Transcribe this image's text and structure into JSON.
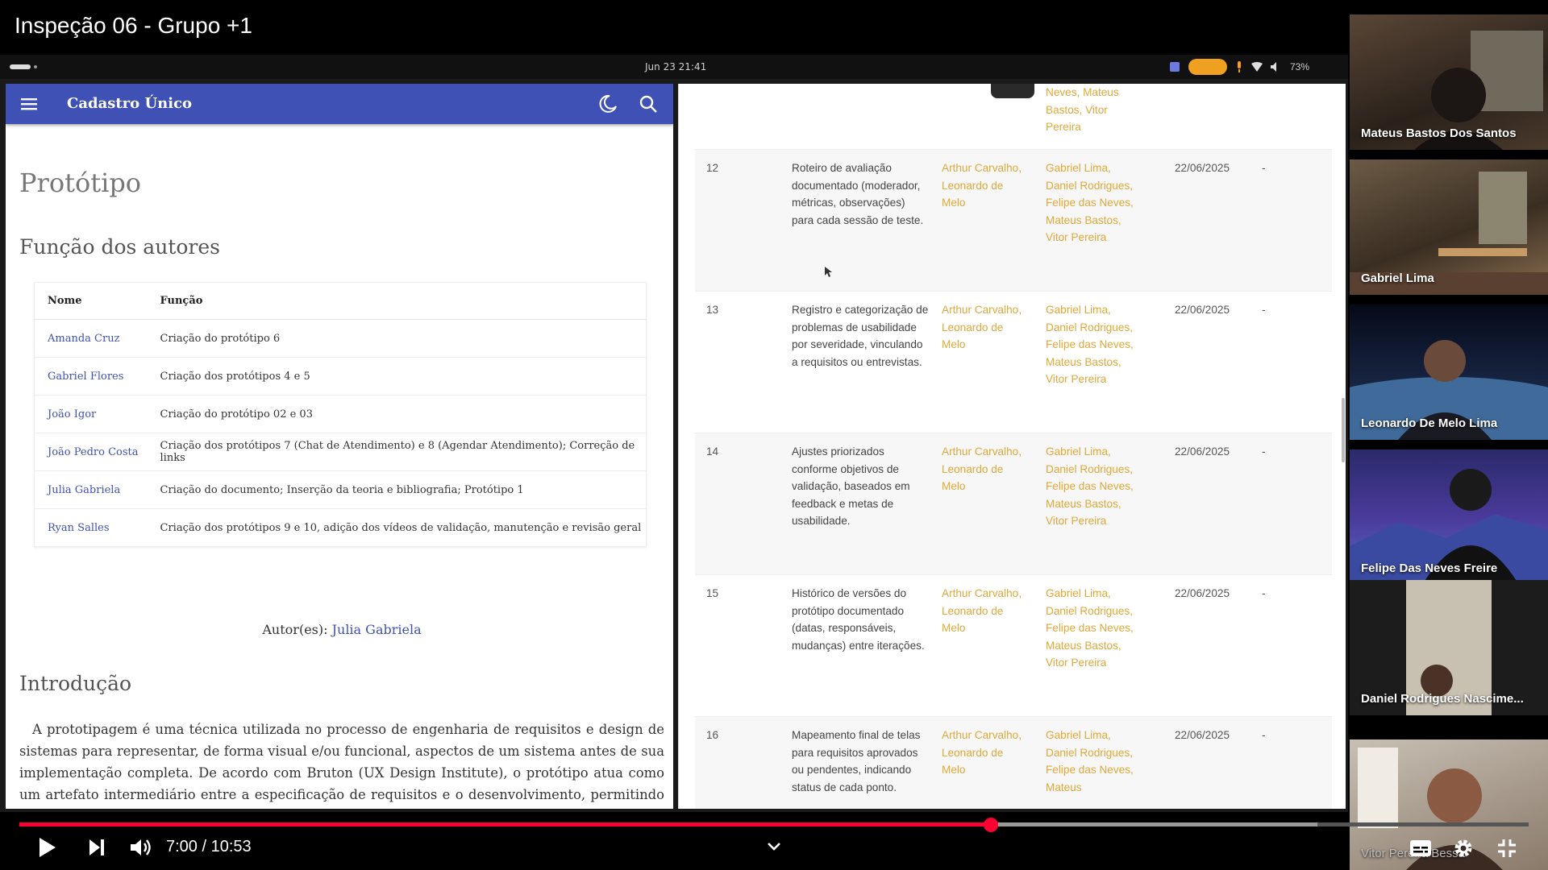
{
  "video": {
    "title": "Inspeção 06 - Grupo +1",
    "time_current": "7:00",
    "time_sep": " / ",
    "time_total": "10:53",
    "progress_fraction": 0.6437,
    "buffered_fraction": 0.86,
    "accent_color": "#ff0033"
  },
  "statusbar": {
    "datetime": "Jun 23  21:41",
    "battery": "73%"
  },
  "left_app": {
    "appbar_title": "Cadastro Único",
    "appbar_color": "#3f51b5",
    "page_title": "Protótipo",
    "section_authors": "Função dos autores",
    "table_headers": {
      "name": "Nome",
      "role": "Função"
    },
    "authors": [
      {
        "name": "Amanda Cruz",
        "role": "Criação do protótipo 6"
      },
      {
        "name": "Gabriel Flores",
        "role": "Criação dos protótipos 4 e 5"
      },
      {
        "name": "João Igor",
        "role": "Criação do protótipo 02 e 03"
      },
      {
        "name": "João Pedro Costa",
        "role": "Criação dos protótipos 7 (Chat de Atendimento) e 8 (Agendar Atendimento); Correção de links"
      },
      {
        "name": "Julia Gabriela",
        "role": "Criação do documento; Inserção da teoria e bibliografia; Protótipo 1"
      },
      {
        "name": "Ryan Salles",
        "role": "Criação dos protótipos 9 e 10, adição dos vídeos de validação, manutenção e revisão geral"
      }
    ],
    "author_label": "Autor(es): ",
    "author_link": "Julia Gabriela",
    "section_intro": "Introdução",
    "intro_text": "A prototipagem é uma técnica utilizada no processo de engenharia de requisitos e design de sistemas para representar, de forma visual e/ou funcional, aspectos de um sistema antes de sua implementação completa. De acordo com Bruton (UX Design Institute), o protótipo atua como um artefato intermediário entre a especificação de requisitos e o desenvolvimento, permitindo validar funcionalidades, fluxos de interação e regras de negócio com os stakeholders. Já Boicheva (2024) reforça que a prototipagem é essencial para detectar inconsistências, ambiguidade e requisitos incompletos, antecipando problemas que poderiam surgir nas fases posteriores do ciclo de vida do"
  },
  "right_app": {
    "top_partial": "Neves, Mateus Bastos, Vitor Pereira",
    "rows": [
      {
        "num": "12",
        "desc": "Roteiro de avaliação documentado (moderador, métricas, observações) para cada sessão de teste.",
        "resp": "Arthur Carvalho, Leonardo de Melo",
        "part": "Gabriel Lima, Daniel Rodrigues, Felipe das Neves, Mateus Bastos, Vitor Pereira",
        "date": "22/06/2025",
        "dash": "-"
      },
      {
        "num": "13",
        "desc": "Registro e categorização de problemas de usabilidade por severidade, vinculando a requisitos ou entrevistas.",
        "resp": "Arthur Carvalho, Leonardo de Melo",
        "part": "Gabriel Lima, Daniel Rodrigues, Felipe das Neves, Mateus Bastos, Vitor Pereira",
        "date": "22/06/2025",
        "dash": "-"
      },
      {
        "num": "14",
        "desc": "Ajustes priorizados conforme objetivos de validação, baseados em feedback e metas de usabilidade.",
        "resp": "Arthur Carvalho, Leonardo de Melo",
        "part": "Gabriel Lima, Daniel Rodrigues, Felipe das Neves, Mateus Bastos, Vitor Pereira",
        "date": "22/06/2025",
        "dash": "-"
      },
      {
        "num": "15",
        "desc": "Histórico de versões do protótipo documentado (datas, responsáveis, mudanças) entre iterações.",
        "resp": "Arthur Carvalho, Leonardo de Melo",
        "part": "Gabriel Lima, Daniel Rodrigues, Felipe das Neves, Mateus Bastos, Vitor Pereira",
        "date": "22/06/2025",
        "dash": "-"
      },
      {
        "num": "16",
        "desc": "Mapeamento final de telas para requisitos aprovados ou pendentes, indicando status de cada ponto.",
        "resp": "Arthur Carvalho, Leonardo de Melo",
        "part": "Gabriel Lima, Daniel Rodrigues, Felipe das Neves, Mateus",
        "date": "22/06/2025",
        "dash": "-"
      }
    ],
    "link_color": "#e0a838"
  },
  "participants": [
    {
      "name": "Mateus Bastos Dos Santos"
    },
    {
      "name": "Gabriel Lima"
    },
    {
      "name": "Leonardo De Melo Lima"
    },
    {
      "name": "Felipe Das Neves Freire"
    },
    {
      "name": "Daniel Rodrigues Nascime..."
    },
    {
      "name": "Vitor Pereira Bessa"
    }
  ],
  "icons": {
    "menu": "hamburger-icon",
    "dark_mode": "moon-icon",
    "search": "search-icon",
    "share": "share-icon",
    "play": "play-icon",
    "next": "next-icon",
    "volume": "volume-icon",
    "captions": "captions-icon",
    "settings": "gear-icon",
    "exit_fullscreen": "exit-fullscreen-icon"
  }
}
